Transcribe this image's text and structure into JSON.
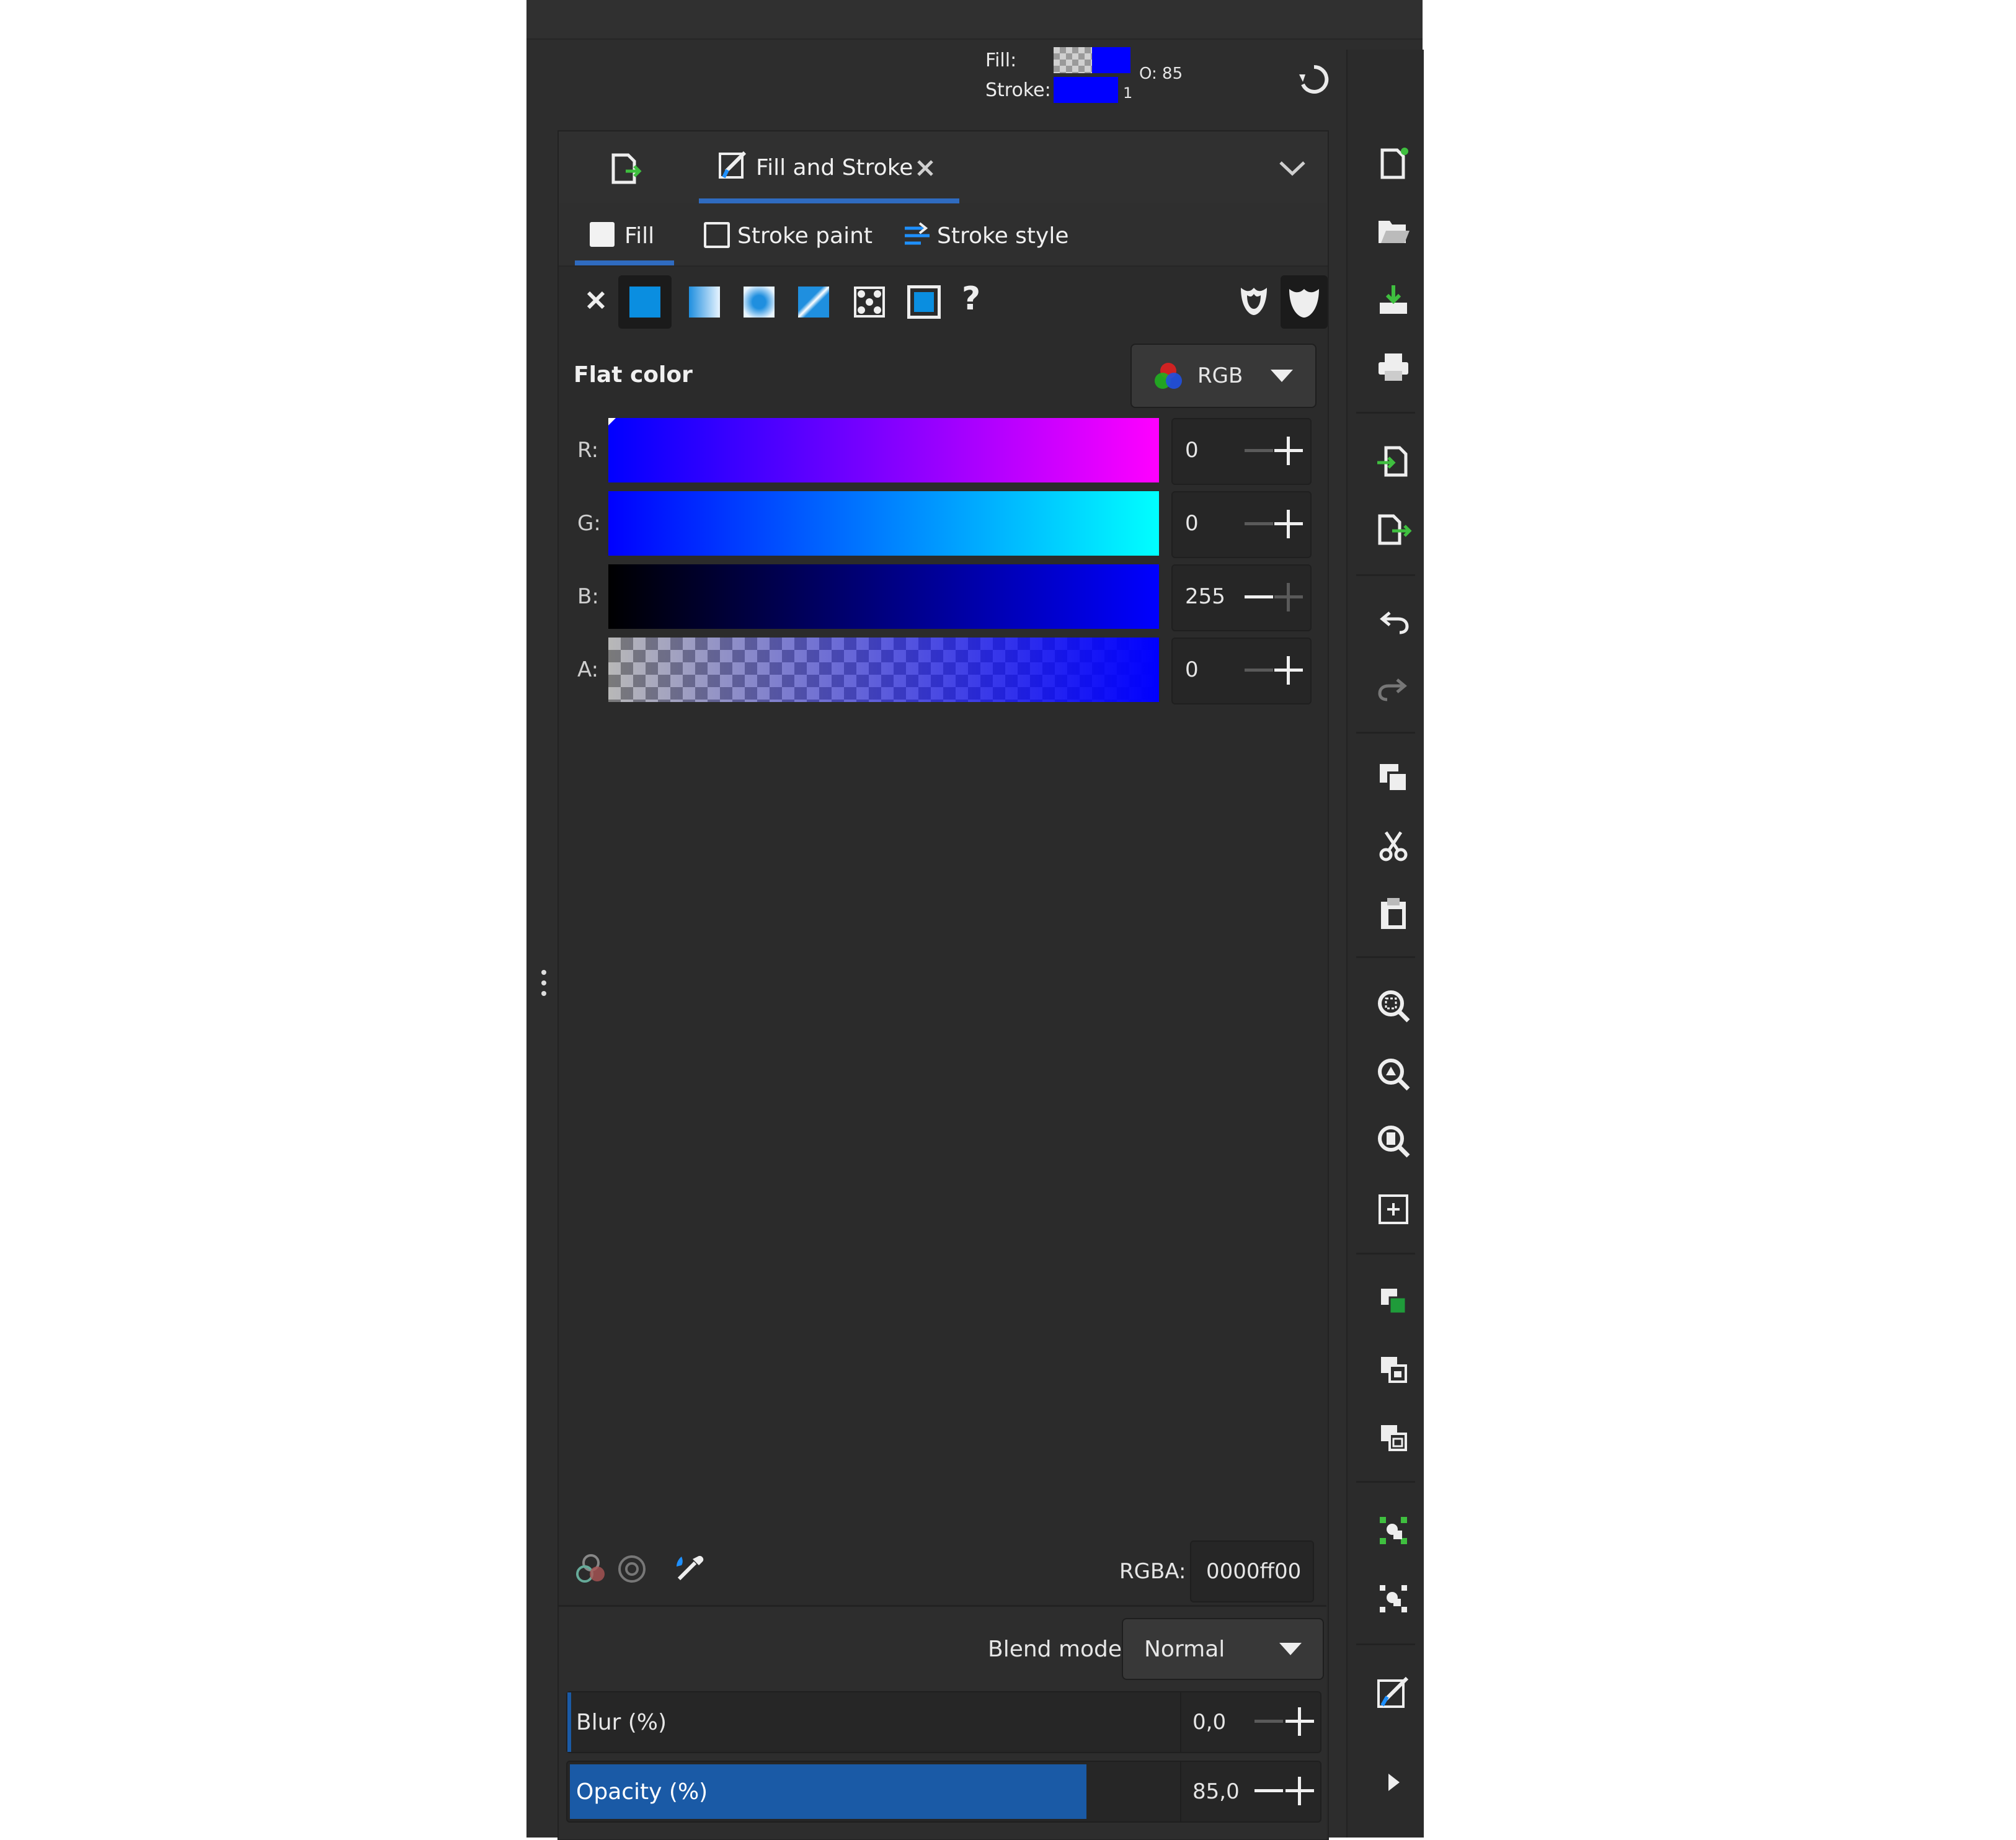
{
  "indicator": {
    "fill_label": "Fill:",
    "stroke_label": "Stroke:",
    "opacity_text": "O: 85",
    "stroke_width": "1",
    "fill_color": "#0000ff",
    "stroke_color": "#0000ff"
  },
  "dock": {
    "tab_title": "Fill and Stroke",
    "subtabs": [
      "Fill",
      "Stroke paint",
      "Stroke style"
    ],
    "active_subtab": "Fill"
  },
  "paint_types": [
    "no-paint-icon",
    "flat-color-icon",
    "linear-gradient-icon",
    "radial-gradient-icon",
    "mesh-gradient-icon",
    "pattern-icon",
    "swatch-icon",
    "unset-icon"
  ],
  "flat_color": {
    "title": "Flat color",
    "mode": "RGB",
    "channels": [
      {
        "label": "R:",
        "value": "0"
      },
      {
        "label": "G:",
        "value": "0"
      },
      {
        "label": "B:",
        "value": "255"
      },
      {
        "label": "A:",
        "value": "0"
      }
    ],
    "rgba_label": "RGBA:",
    "rgba_value": "0000ff00"
  },
  "blend": {
    "label": "Blend mode:",
    "value": "Normal"
  },
  "blur": {
    "label": "Blur (%)",
    "value": "0,0"
  },
  "opacity": {
    "label": "Opacity (%)",
    "value": "85,0",
    "level": 0.85
  },
  "colors": {
    "accent": "#1a5aa6",
    "panel": "#2b2b2b",
    "tab_underline": "#2f6bc0"
  },
  "sidebar_icons": [
    "document-new-icon",
    "document-open-icon",
    "document-save-icon",
    "print-icon",
    "import-icon",
    "export-icon",
    "undo-icon",
    "redo-icon",
    "copy-icon",
    "cut-icon",
    "paste-icon",
    "zoom-selection-icon",
    "zoom-drawing-icon",
    "zoom-page-icon",
    "zoom-center-icon",
    "duplicate-icon",
    "clone-icon",
    "unlink-clone-icon",
    "group-icon",
    "ungroup-icon",
    "fill-stroke-icon",
    "expand-right-icon"
  ]
}
